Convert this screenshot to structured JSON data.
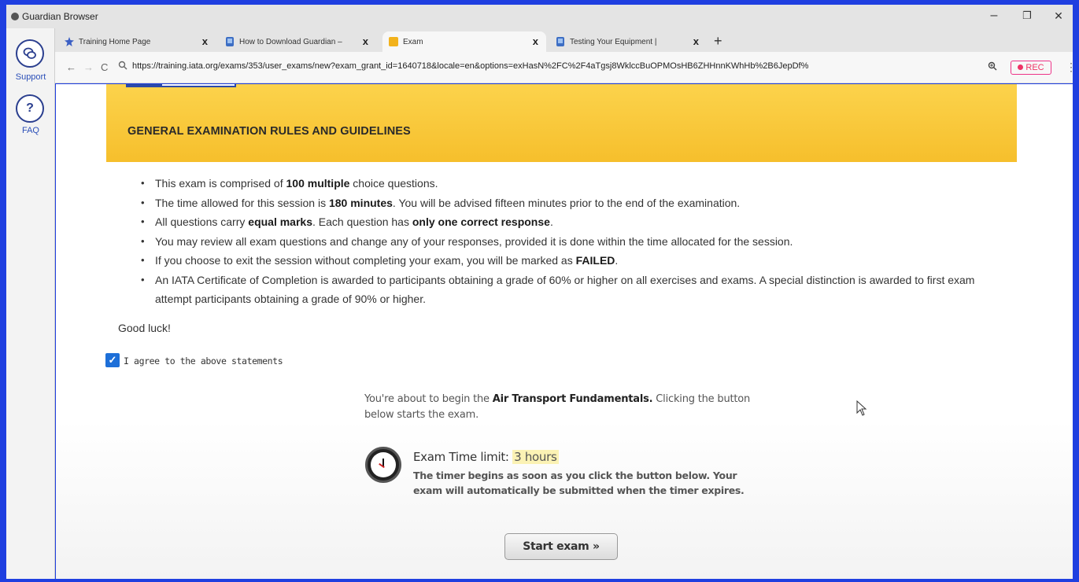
{
  "window": {
    "title": "Guardian Browser",
    "minimize": "–",
    "maximize": "❐",
    "close": "✕"
  },
  "tabs": [
    {
      "label": "Training Home Page",
      "active": false
    },
    {
      "label": "How to Download Guardian –",
      "active": false
    },
    {
      "label": "Exam",
      "active": true
    },
    {
      "label": "Testing Your Equipment |",
      "active": false
    }
  ],
  "tab_close": "x",
  "new_tab": "+",
  "addressbar": {
    "back": "←",
    "forward": "→",
    "reload": "C",
    "url": "https://training.iata.org/exams/353/user_exams/new?exam_grant_id=1640718&locale=en&options=exHasN%2FC%2F4aTgsj8WklccBuOPMOsHB6ZHHnnKWhHb%2B6JepDf%",
    "rec": "REC",
    "menu": "⋮"
  },
  "sidebar": {
    "support_label": "Support",
    "faq_label": "FAQ"
  },
  "content": {
    "heading": "GENERAL EXAMINATION RULES AND GUIDELINES",
    "rules": [
      {
        "pre": "This exam is comprised of ",
        "bold": "100 multiple",
        "post": " choice questions."
      },
      {
        "pre": "The time allowed for this session is ",
        "bold": "180 minutes",
        "post": ". You will be advised fifteen minutes prior to the end of the examination."
      },
      {
        "pre": "All questions carry ",
        "bold": "equal marks",
        "mid": ". Each question has ",
        "bold2": "only one correct response",
        "post": "."
      },
      {
        "pre": "You may review all exam questions and change any of your responses, provided it is done within the time allocated for the session.",
        "bold": "",
        "post": ""
      },
      {
        "pre": "If you choose to exit the session without completing your exam, you will be marked as ",
        "bold": "FAILED",
        "post": "."
      },
      {
        "pre": "An IATA Certificate of Completion is awarded to participants obtaining a grade of 60% or higher on all exercises and exams. A special distinction is awarded to first exam attempt participants obtaining a grade of 90% or higher.",
        "bold": "",
        "post": ""
      }
    ],
    "good_luck": "Good luck!",
    "agree_label": "I agree to the above statements",
    "agree_checked": true,
    "about_pre": "You're about to begin the ",
    "about_course": "Air Transport Fundamentals.",
    "about_post": " Clicking the button below starts the exam.",
    "limit_label": "Exam Time limit: ",
    "limit_value": "3 hours",
    "limit_desc": "The timer begins as soon as you click the button below. Your exam will automatically be submitted when the timer expires.",
    "start_button": "Start exam »"
  },
  "colors": {
    "frame": "#1f3fe0",
    "banner": "#f8c637",
    "checkbox": "#1d6fd8"
  }
}
